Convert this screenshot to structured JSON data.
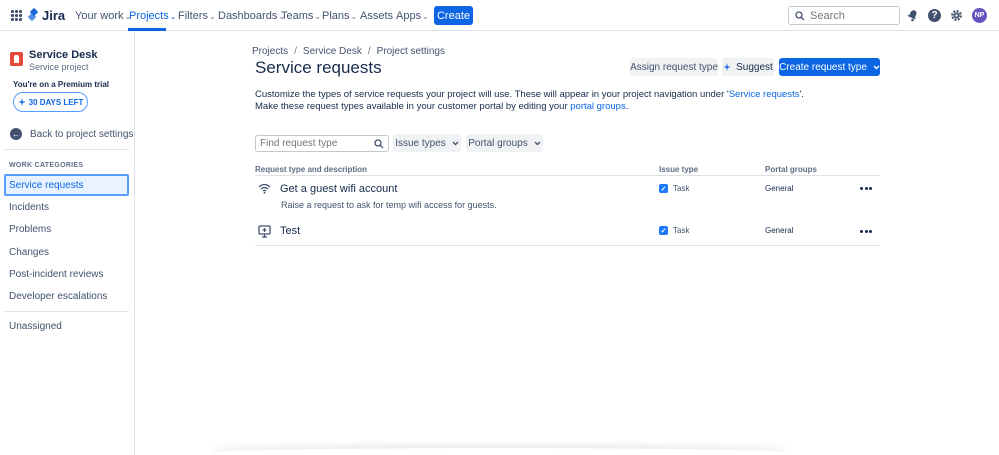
{
  "topnav": {
    "app_name": "Jira",
    "items": [
      {
        "label": "Your work",
        "chevron": "⌄"
      },
      {
        "label": "Projects",
        "chevron": "⌄",
        "active": true
      },
      {
        "label": "Filters",
        "chevron": "⌄"
      },
      {
        "label": "Dashboards",
        "chevron": "⌄"
      },
      {
        "label": "Teams",
        "chevron": "⌄"
      },
      {
        "label": "Plans",
        "chevron": "⌄"
      },
      {
        "label": "Assets",
        "chevron": ""
      },
      {
        "label": "Apps",
        "chevron": "⌄"
      }
    ],
    "create_label": "Create",
    "search_placeholder": "Search",
    "avatar_initials": "NP",
    "help_glyph": "?"
  },
  "sidebar": {
    "project_name": "Service Desk",
    "project_type": "Service project",
    "trial_text": "You're on a Premium trial",
    "days_left": "30 DAYS LEFT",
    "back_label": "Back to project settings",
    "section_label": "WORK CATEGORIES",
    "links": [
      {
        "label": "Service requests",
        "active": true
      },
      {
        "label": "Incidents"
      },
      {
        "label": "Problems"
      },
      {
        "label": "Changes"
      },
      {
        "label": "Post-incident reviews"
      },
      {
        "label": "Developer escalations"
      }
    ],
    "unassigned_label": "Unassigned"
  },
  "main": {
    "breadcrumbs": [
      "Projects",
      "Service Desk",
      "Project settings"
    ],
    "breadcrumb_sep": "/",
    "title": "Service requests",
    "assign_label": "Assign request type",
    "suggest_label": "Suggest",
    "create_request_label": "Create request type",
    "description": {
      "line1_prefix": "Customize the types of service requests your project will use. These will appear in your project navigation under '",
      "line1_link": "Service requests",
      "line1_suffix": "'.",
      "line2_prefix": "Make these request types available in your customer portal by editing your ",
      "line2_link": "portal groups",
      "line2_suffix": "."
    },
    "filter_placeholder": "Find request type",
    "issue_types_label": "Issue types",
    "portal_groups_label": "Portal groups",
    "table": {
      "headers": [
        "Request type and description",
        "Issue type",
        "Portal groups"
      ],
      "rows": [
        {
          "name": "Get a guest wifi account",
          "description": "Raise a request to ask for temp wifi access for guests.",
          "issue_type": "Task",
          "portal_group": "General",
          "icon": "wifi-icon"
        },
        {
          "name": "Test",
          "description": "",
          "issue_type": "Task",
          "portal_group": "General",
          "icon": "monitor-icon"
        }
      ]
    }
  },
  "colors": {
    "brand": "#0c66e4",
    "project_icon": "#e5493a",
    "avatar": "#6554c0"
  }
}
